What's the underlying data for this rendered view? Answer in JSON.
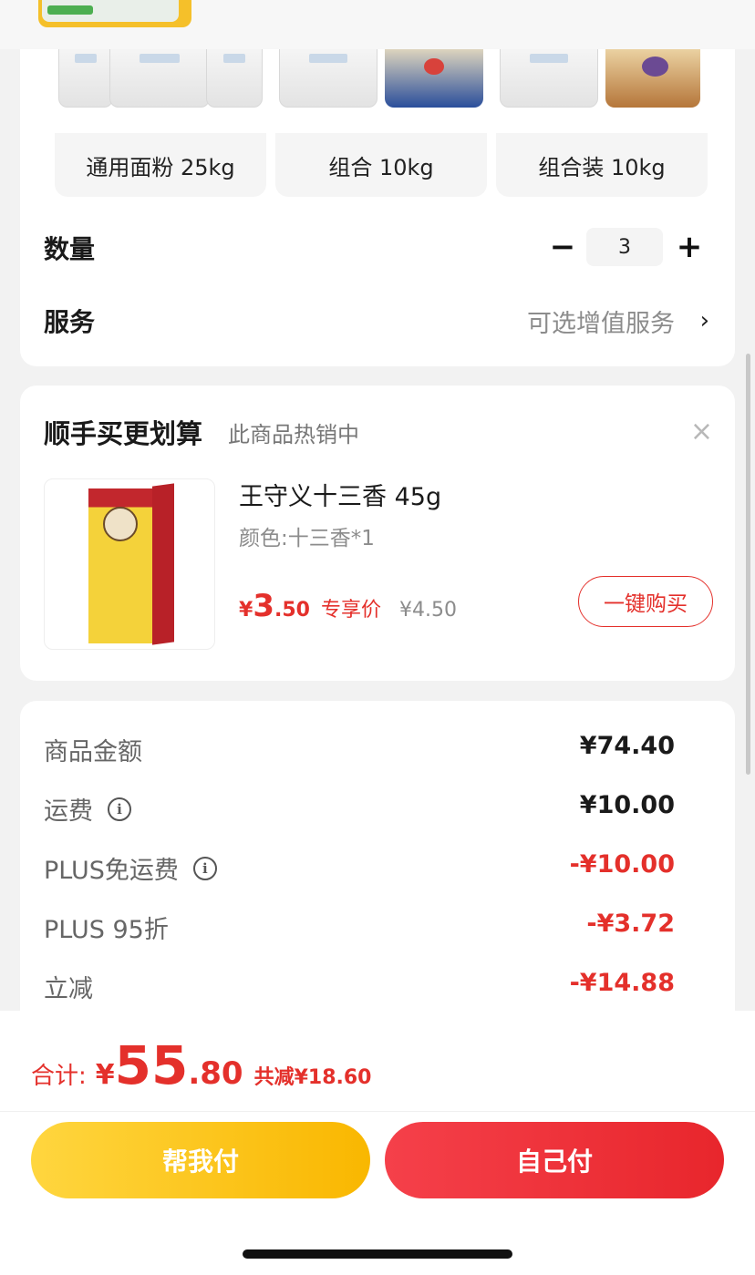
{
  "variants": [
    {
      "label": "通用面粉 25kg"
    },
    {
      "label": "组合 10kg"
    },
    {
      "label": "组合装 10kg"
    }
  ],
  "quantity": {
    "label": "数量",
    "minus": "−",
    "value": "3",
    "plus": "+"
  },
  "service": {
    "label": "服务",
    "hint": "可选增值服务",
    "chevron": "›"
  },
  "addon": {
    "title": "顺手买更划算",
    "subtitle": "此商品热销中",
    "close": "×",
    "product": {
      "name": "王守义十三香 45g",
      "spec": "颜色:十三香*1",
      "price_symbol": "¥",
      "price_int": "3",
      "price_dec": ".50",
      "price_tag": "专享价",
      "original_price": "¥4.50",
      "buy_label": "一键购买"
    }
  },
  "summary": [
    {
      "label": "商品金额",
      "value": "¥74.40",
      "info": false,
      "red": false
    },
    {
      "label": "运费",
      "value": "¥10.00",
      "info": true,
      "red": false
    },
    {
      "label": "PLUS免运费",
      "value": "-¥10.00",
      "info": true,
      "red": true
    },
    {
      "label": "PLUS 95折",
      "value": "-¥3.72",
      "info": false,
      "red": true
    },
    {
      "label": "立减",
      "value": "-¥14.88",
      "info": false,
      "red": true
    }
  ],
  "total": {
    "label": "合计:",
    "symbol": "¥",
    "int": "55",
    "dec": ".80",
    "saved": "共减¥18.60"
  },
  "buttons": {
    "help_pay": "帮我付",
    "self_pay": "自己付"
  },
  "info_icon_glyph": "i",
  "colors": {
    "accent_red": "#e4302b",
    "yellow": "#f9b700",
    "button_red": "#e8262c"
  }
}
